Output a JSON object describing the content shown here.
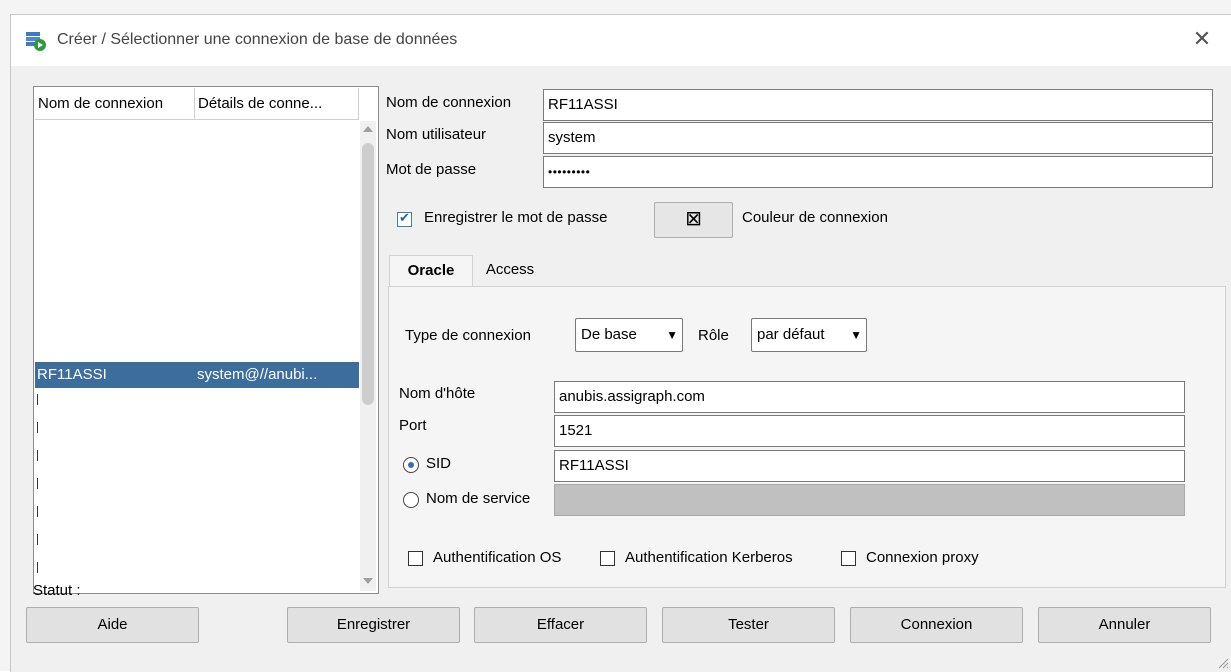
{
  "dialog": {
    "title": "Créer / Sélectionner une connexion de base de données",
    "close_symbol": "✕"
  },
  "list": {
    "col_name": "Nom de connexion",
    "col_details": "Détails de conne...",
    "rows": [
      {
        "name": "RF11ASSI",
        "details": "system@//anubi..."
      }
    ]
  },
  "form": {
    "conn_name_label": "Nom de connexion",
    "conn_name_value": "RF11ASSI",
    "user_label": "Nom utilisateur",
    "user_value": "system",
    "password_label": "Mot de passe",
    "password_value": "•••••••••",
    "save_password_label": "Enregistrer le mot de passe",
    "save_password_checked": true,
    "color_label": "Couleur de connexion",
    "color_icon": "⊠"
  },
  "tabs": [
    "Oracle",
    "Access"
  ],
  "oracle": {
    "type_label": "Type de connexion",
    "type_value": "De base",
    "role_label": "Rôle",
    "role_value": "par défaut",
    "host_label": "Nom d'hôte",
    "host_value": "anubis.assigraph.com",
    "port_label": "Port",
    "port_value": "1521",
    "sid_label": "SID",
    "sid_value": "RF11ASSI",
    "service_label": "Nom de service",
    "service_value": "",
    "os_auth_label": "Authentification OS",
    "kerberos_label": "Authentification Kerberos",
    "proxy_label": "Connexion proxy"
  },
  "status_label": "Statut :",
  "buttons": {
    "help": "Aide",
    "save": "Enregistrer",
    "clear": "Effacer",
    "test": "Tester",
    "connect": "Connexion",
    "cancel": "Annuler"
  },
  "icons": {
    "app": "db-connection-icon",
    "close": "close-icon",
    "dropdown": "chevron-down-icon"
  },
  "colors": {
    "selection": "#3d6d9d",
    "dialog_bg": "#f0f0f0"
  }
}
